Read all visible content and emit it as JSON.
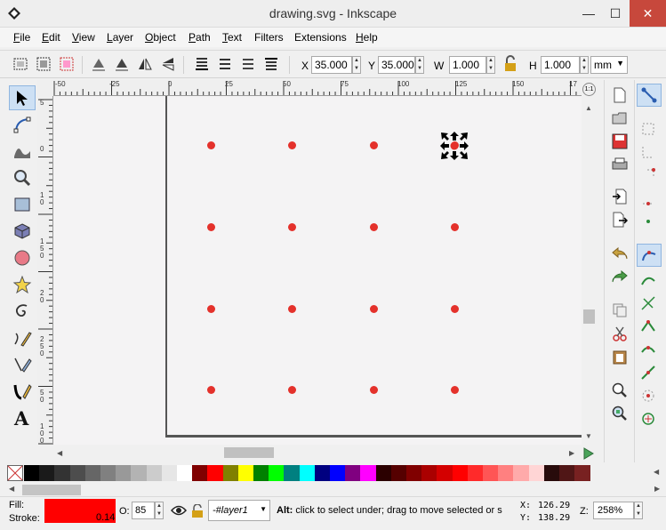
{
  "window": {
    "title": "drawing.svg - Inkscape",
    "minimize": "—",
    "maximize": "☐",
    "close": "✕"
  },
  "menu": [
    {
      "ul": "F",
      "rest": "ile"
    },
    {
      "ul": "E",
      "rest": "dit"
    },
    {
      "ul": "V",
      "rest": "iew"
    },
    {
      "ul": "L",
      "rest": "ayer"
    },
    {
      "ul": "O",
      "rest": "bject"
    },
    {
      "ul": "P",
      "rest": "ath"
    },
    {
      "ul": "T",
      "rest": "ext"
    },
    {
      "ul": "",
      "rest": "Filters"
    },
    {
      "ul": "",
      "rest": "Extensions"
    },
    {
      "ul": "H",
      "rest": "elp"
    }
  ],
  "controls": {
    "x_label": "X",
    "x_value": "35.000",
    "y_label": "Y",
    "y_value": "35.000",
    "w_label": "W",
    "w_value": "1.000",
    "h_label": "H",
    "h_value": "1.000",
    "unit": "mm"
  },
  "rulers": {
    "top": [
      "-50",
      "-25",
      "0",
      "25",
      "50",
      "75",
      "100",
      "125",
      "150",
      "17"
    ],
    "left": [
      "5",
      "0",
      "1\n0",
      "1\n5\n0",
      "2\n0",
      "2\n5\n0",
      "5\n0",
      "1\n0\n0"
    ]
  },
  "toolbox": [
    "selector-tool",
    "node-tool",
    "tweak-tool",
    "zoom-tool",
    "rect-tool",
    "3dbox-tool",
    "ellipse-tool",
    "star-tool",
    "spiral-tool",
    "pencil-tool",
    "pen-tool",
    "calligraphy-tool",
    "text-tool"
  ],
  "palette": {
    "colors": [
      "#000000",
      "#1a1a1a",
      "#333333",
      "#4d4d4d",
      "#666666",
      "#808080",
      "#999999",
      "#b3b3b3",
      "#cccccc",
      "#e6e6e6",
      "#ffffff",
      "#800000",
      "#ff0000",
      "#808000",
      "#ffff00",
      "#008000",
      "#00ff00",
      "#008080",
      "#00ffff",
      "#000080",
      "#0000ff",
      "#800080",
      "#ff00ff",
      "#2b0000",
      "#550000",
      "#800000",
      "#aa0000",
      "#d40000",
      "#ff0000",
      "#ff2a2a",
      "#ff5555",
      "#ff8080",
      "#ffaaaa",
      "#ffd5d5",
      "#280b0b",
      "#501616",
      "#782121"
    ]
  },
  "status": {
    "fill_label": "Fill:",
    "stroke_label": "Stroke:",
    "fill_color": "#ff0000",
    "stroke_width": "0.14",
    "opacity_label": "O:",
    "opacity_value": "85",
    "layer": "-#layer1",
    "message_bold": "Alt:",
    "message": " click to select under; drag to move selected or s",
    "x_label": "X:",
    "x_value": "126.29",
    "y_label": "Y:",
    "y_value": "138.29",
    "zoom_label": "Z:",
    "zoom_value": "258%"
  }
}
